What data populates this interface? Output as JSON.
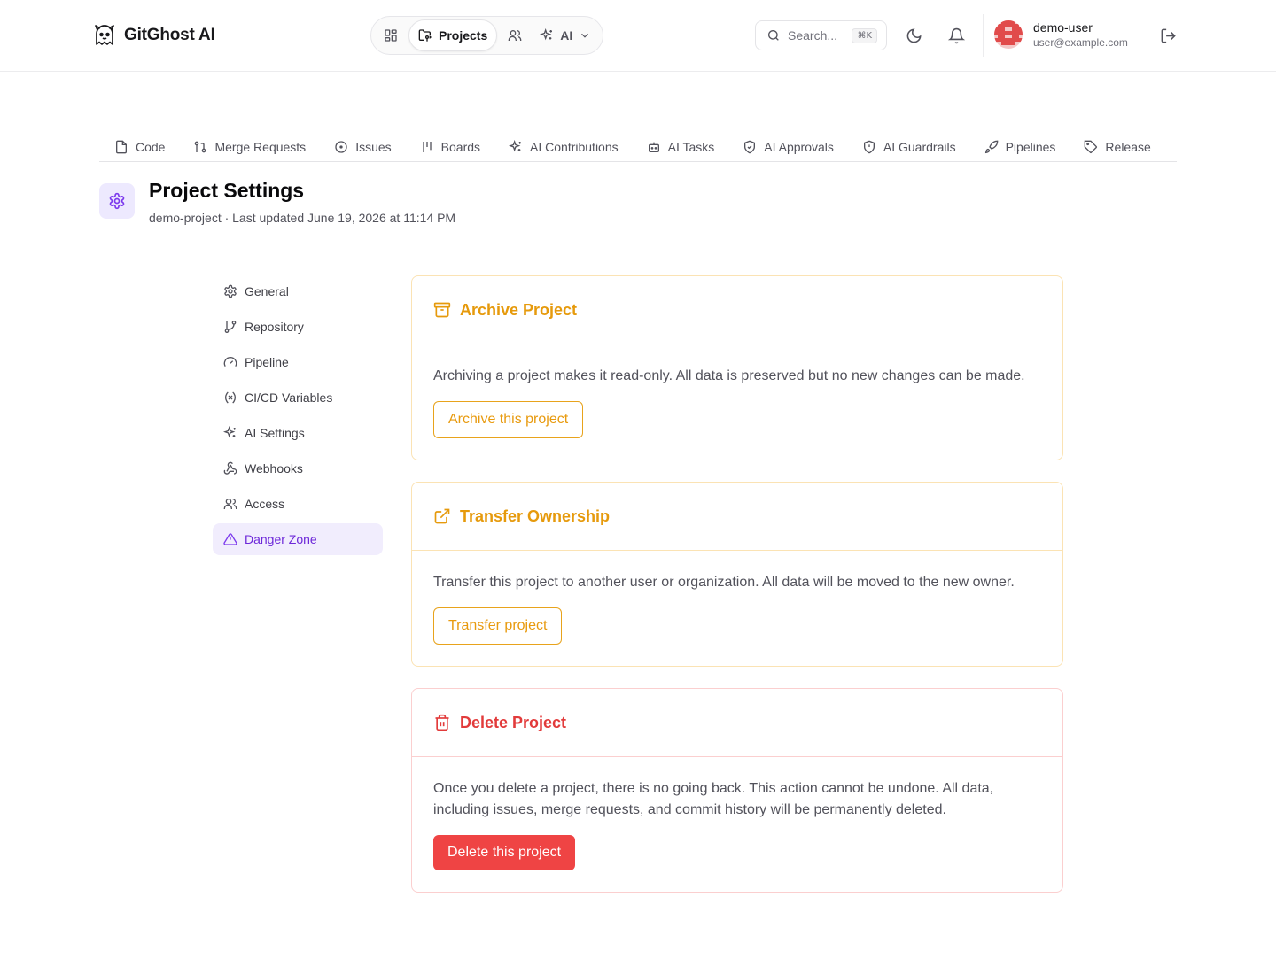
{
  "header": {
    "brand": "GitGhost AI",
    "nav": {
      "projects_label": "Projects",
      "ai_label": "AI"
    },
    "search": {
      "placeholder": "Search...",
      "shortcut": "⌘K"
    },
    "user": {
      "name": "demo-user",
      "email": "user@example.com"
    }
  },
  "tabs": [
    {
      "label": "Code",
      "icon": "file-icon"
    },
    {
      "label": "Merge Requests",
      "icon": "git-pull-request-icon"
    },
    {
      "label": "Issues",
      "icon": "circle-dot-icon"
    },
    {
      "label": "Boards",
      "icon": "kanban-icon"
    },
    {
      "label": "AI Contributions",
      "icon": "sparkles-icon"
    },
    {
      "label": "AI Tasks",
      "icon": "bot-icon"
    },
    {
      "label": "AI Approvals",
      "icon": "shield-check-icon"
    },
    {
      "label": "AI Guardrails",
      "icon": "shield-alert-icon"
    },
    {
      "label": "Pipelines",
      "icon": "rocket-icon"
    },
    {
      "label": "Release",
      "icon": "tag-icon"
    }
  ],
  "page": {
    "title": "Project Settings",
    "subtitle": "demo-project · Last updated June 19, 2026 at 11:14 PM"
  },
  "sidenav": [
    {
      "label": "General",
      "icon": "gear-icon"
    },
    {
      "label": "Repository",
      "icon": "git-branch-icon"
    },
    {
      "label": "Pipeline",
      "icon": "gauge-icon"
    },
    {
      "label": "CI/CD Variables",
      "icon": "variable-icon"
    },
    {
      "label": "AI Settings",
      "icon": "sparkles-icon"
    },
    {
      "label": "Webhooks",
      "icon": "webhook-icon"
    },
    {
      "label": "Access",
      "icon": "users-icon"
    },
    {
      "label": "Danger Zone",
      "icon": "warning-triangle-icon",
      "active": true
    }
  ],
  "cards": {
    "archive": {
      "title": "Archive Project",
      "text": "Archiving a project makes it read-only. All data is preserved but no new changes can be made.",
      "button": "Archive this project"
    },
    "transfer": {
      "title": "Transfer Ownership",
      "text": "Transfer this project to another user or organization. All data will be moved to the new owner.",
      "button": "Transfer project"
    },
    "delete": {
      "title": "Delete Project",
      "text": "Once you delete a project, there is no going back. This action cannot be undone. All data, including issues, merge requests, and commit history will be permanently deleted.",
      "button": "Delete this project"
    }
  },
  "colors": {
    "accent": "#7c3aed",
    "warning": "#e69a0c",
    "danger": "#ef4444"
  }
}
